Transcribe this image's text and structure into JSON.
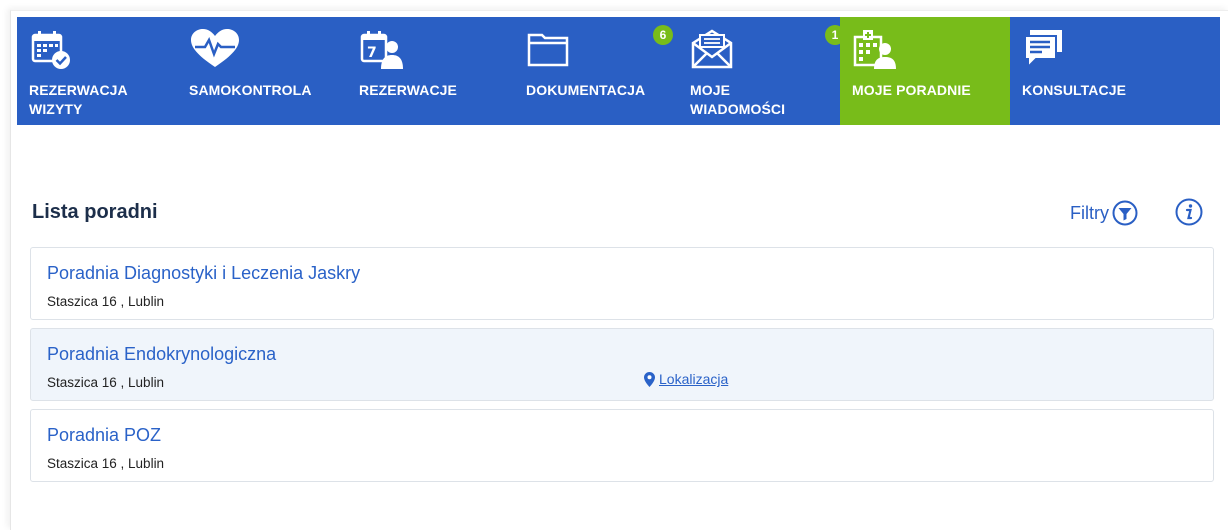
{
  "nav": {
    "items": [
      {
        "label_line1": "REZERWACJA",
        "label_line2": "WIZYTY",
        "icon": "calendar-check-icon"
      },
      {
        "label_line1": "SAMOKONTROLA",
        "label_line2": "",
        "icon": "heart-pulse-icon"
      },
      {
        "label_line1": "REZERWACJE",
        "label_line2": "",
        "icon": "calendar-user-icon"
      },
      {
        "label_line1": "DOKUMENTACJA",
        "label_line2": "",
        "icon": "folder-icon",
        "badge": "6"
      },
      {
        "label_line1": "MOJE",
        "label_line2": "WIADOMOŚCI",
        "icon": "envelope-icon",
        "badge": "1"
      },
      {
        "label_line1": "MOJE PORADNIE",
        "label_line2": "",
        "icon": "clinic-building-icon",
        "active": true
      },
      {
        "label_line1": "KONSULTACJE",
        "label_line2": "",
        "icon": "chat-icon"
      }
    ]
  },
  "page": {
    "title": "Lista poradni",
    "filters_label": "Filtry"
  },
  "clinics": [
    {
      "name": "Poradnia Diagnostyki i Leczenia Jaskry",
      "address": "Staszica 16 , Lublin"
    },
    {
      "name": "Poradnia Endokrynologiczna",
      "address": "Staszica 16 , Lublin",
      "location_label": "Lokalizacja"
    },
    {
      "name": "Poradnia POZ",
      "address": "Staszica 16 , Lublin"
    }
  ],
  "colors": {
    "nav_bg": "#2a5fc4",
    "active_bg": "#78bc1a",
    "link": "#2a62c8",
    "title": "#1c2e4a"
  }
}
